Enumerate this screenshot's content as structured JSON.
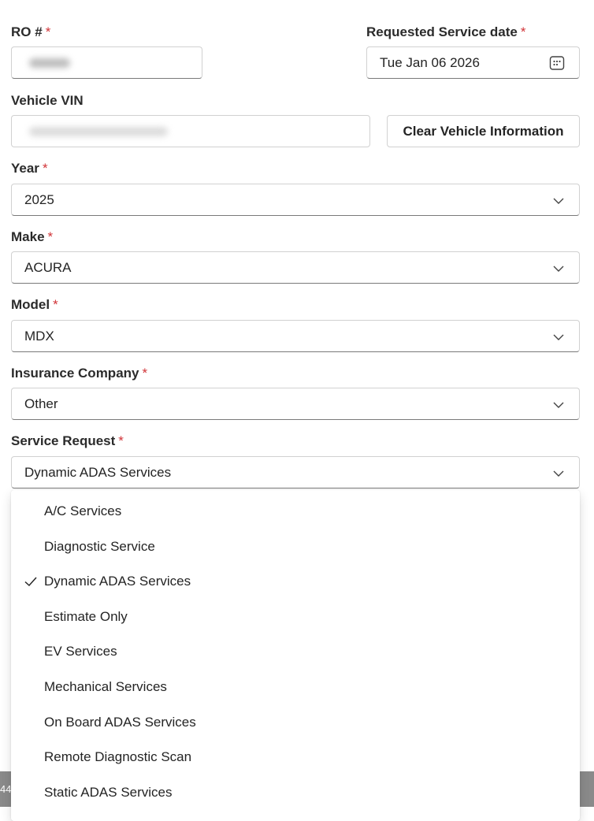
{
  "form": {
    "ro": {
      "label": "RO #",
      "required_mark": "*"
    },
    "service_date": {
      "label": "Requested Service date",
      "required_mark": "*",
      "value": "Tue Jan 06 2026",
      "icon": "calendar-icon"
    },
    "vin": {
      "label": "Vehicle VIN"
    },
    "clear_button": {
      "label": "Clear Vehicle Information"
    },
    "year": {
      "label": "Year",
      "required_mark": "*",
      "value": "2025"
    },
    "make": {
      "label": "Make",
      "required_mark": "*",
      "value": "ACURA"
    },
    "model": {
      "label": "Model",
      "required_mark": "*",
      "value": "MDX"
    },
    "insurance": {
      "label": "Insurance Company",
      "required_mark": "*",
      "value": "Other"
    },
    "service_request": {
      "label": "Service Request",
      "required_mark": "*",
      "value": "Dynamic ADAS Services"
    }
  },
  "dropdown": {
    "options": [
      {
        "label": "A/C Services",
        "selected": false
      },
      {
        "label": "Diagnostic Service",
        "selected": false
      },
      {
        "label": "Dynamic ADAS Services",
        "selected": true
      },
      {
        "label": "Estimate Only",
        "selected": false
      },
      {
        "label": "EV Services",
        "selected": false
      },
      {
        "label": "Mechanical Services",
        "selected": false
      },
      {
        "label": "On Board ADAS Services",
        "selected": false
      },
      {
        "label": "Remote Diagnostic Scan",
        "selected": false
      },
      {
        "label": "Static ADAS Services",
        "selected": false
      }
    ]
  },
  "background": {
    "fragment_text": "44"
  },
  "colors": {
    "required": "#d13438",
    "border": "#d1d1d1",
    "border_bottom": "#7a7a7a",
    "text": "#242424"
  }
}
